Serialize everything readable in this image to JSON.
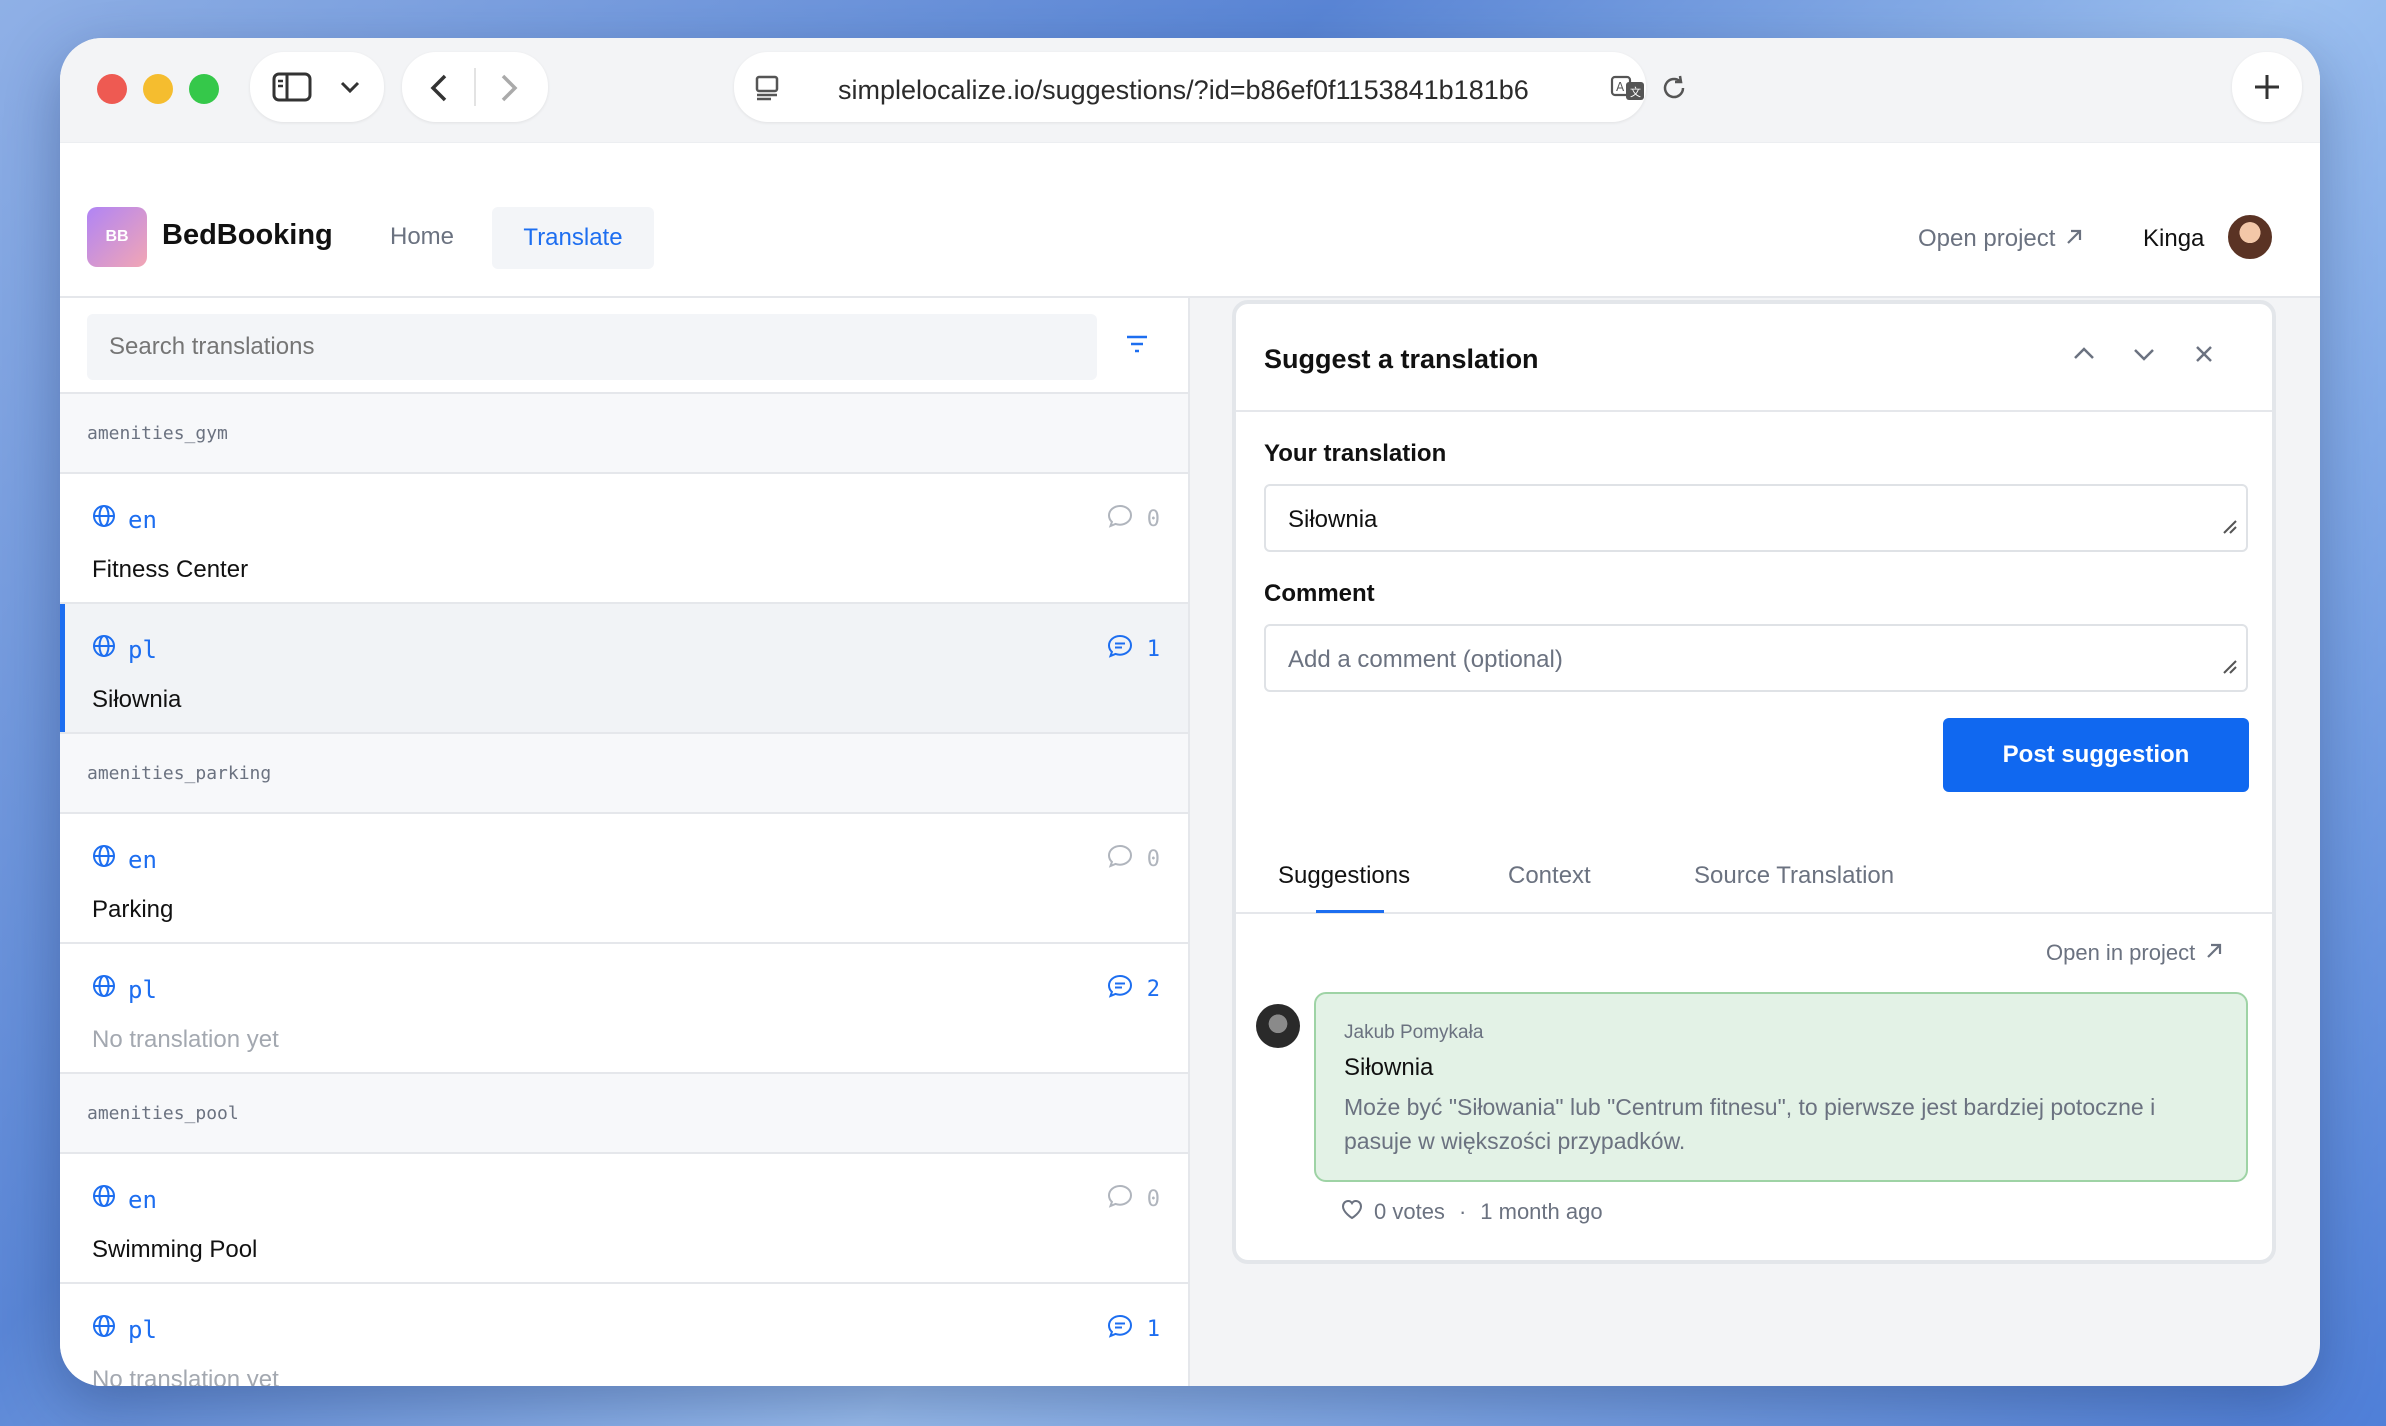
{
  "browser": {
    "url": "simplelocalize.io/suggestions/?id=b86ef0f1153841b181b6",
    "colors": {
      "close": "#ee5a52",
      "minimize": "#f5bd2f",
      "zoom": "#35c84a"
    }
  },
  "app": {
    "logo_initials": "BB",
    "brand": "BedBooking",
    "nav": {
      "home": "Home",
      "translate": "Translate"
    },
    "open_project": "Open project",
    "user_name": "Kinga"
  },
  "left": {
    "search_placeholder": "Search translations",
    "groups": [
      {
        "key": "amenities_gym",
        "rows": [
          {
            "lang": "en",
            "text": "Fitness Center",
            "comments": "0"
          },
          {
            "lang": "pl",
            "text": "Siłownia",
            "comments": "1"
          }
        ]
      },
      {
        "key": "amenities_parking",
        "rows": [
          {
            "lang": "en",
            "text": "Parking",
            "comments": "0"
          },
          {
            "lang": "pl",
            "text": "No translation yet",
            "comments": "2"
          }
        ]
      },
      {
        "key": "amenities_pool",
        "rows": [
          {
            "lang": "en",
            "text": "Swimming Pool",
            "comments": "0"
          },
          {
            "lang": "pl",
            "text": "No translation yet",
            "comments": "1"
          }
        ]
      }
    ]
  },
  "panel": {
    "title": "Suggest a translation",
    "your_translation_label": "Your translation",
    "your_translation_value": "Siłownia",
    "comment_label": "Comment",
    "comment_placeholder": "Add a comment (optional)",
    "post_button": "Post suggestion",
    "tabs": {
      "suggestions": "Suggestions",
      "context": "Context",
      "source": "Source Translation"
    },
    "open_in_project": "Open in project",
    "suggestion": {
      "author": "Jakub Pomykała",
      "text": "Siłownia",
      "comment": "Może być \"Siłowania\" lub \"Centrum fitnesu\", to pierwsze jest bardziej potoczne i pasuje w większości przypadków.",
      "votes": "0 votes",
      "separator": "·",
      "time": "1 month ago"
    }
  }
}
